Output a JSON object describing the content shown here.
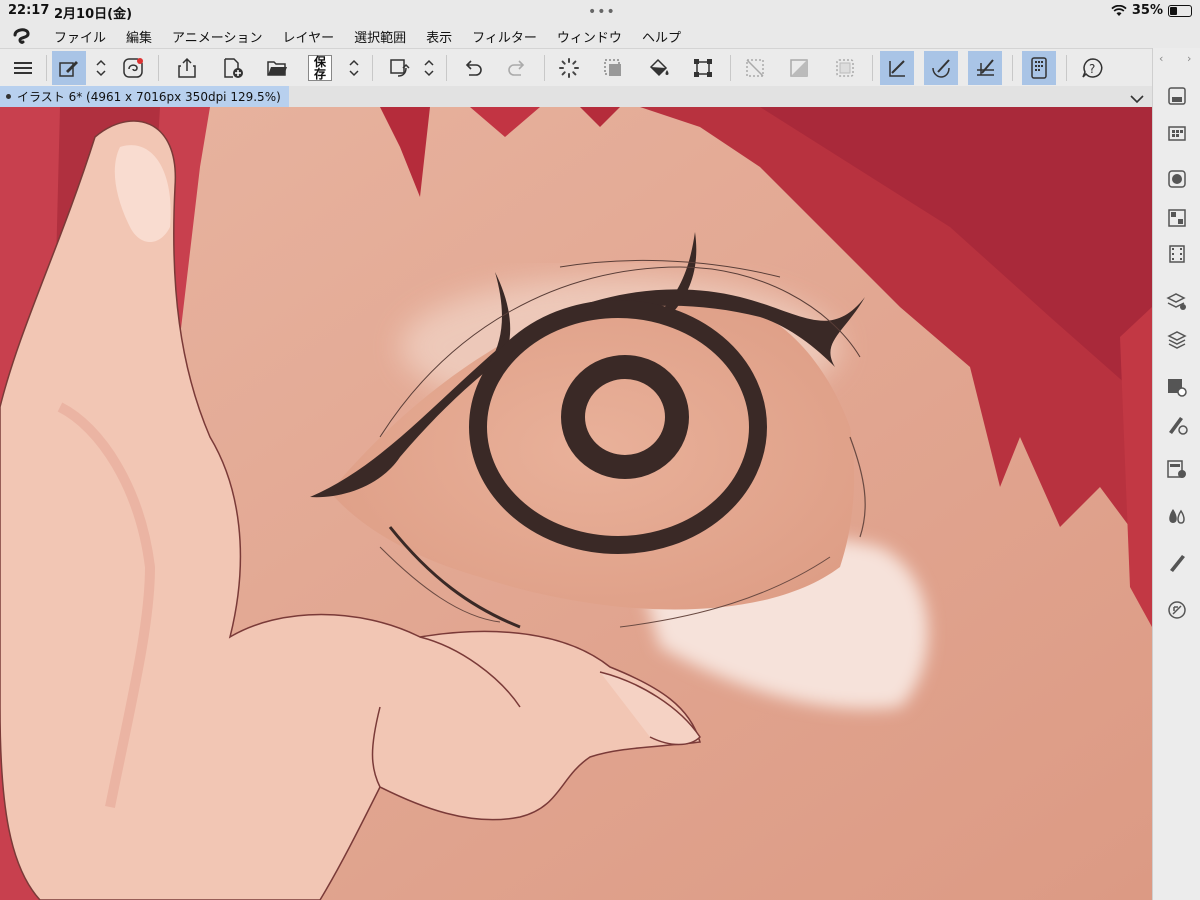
{
  "status": {
    "time": "22:17",
    "date": "2月10日(金)",
    "battery": "35%",
    "battery_level": 0.35
  },
  "menu": [
    "ファイル",
    "編集",
    "アニメーション",
    "レイヤー",
    "選択範囲",
    "表示",
    "フィルター",
    "ウィンドウ",
    "ヘルプ"
  ],
  "toolbar": {
    "save_label_top": "保",
    "save_label_bottom": "存",
    "icons": [
      "menu-icon",
      "edit-icon",
      "quick-access-icon",
      "share-icon",
      "new-file-icon",
      "open-folder-icon",
      "save-icon",
      "rotate-icon",
      "undo-icon",
      "redo-icon",
      "select-spinner-icon",
      "select-dotted-icon",
      "fill-bucket-icon",
      "transform-icon",
      "deselect-icon",
      "gradient-icon",
      "marquee-icon",
      "ruler-snap-icon",
      "brush-snap-icon",
      "angle-snap-icon",
      "device-icon",
      "help-icon"
    ]
  },
  "document": {
    "tab_title": "イラスト 6* (4961 x 7016px 350dpi 129.5%)"
  },
  "right_panel": {
    "icons": [
      "save-panel-icon",
      "material-icon",
      "circle-panel-icon",
      "color-set-icon",
      "animation-icon",
      "layer-property-icon",
      "layers-icon",
      "subtool-settings-icon",
      "tool-property-icon",
      "layer-adjust-icon",
      "color-drop-icon",
      "pen-icon",
      "navigator-icon"
    ]
  },
  "colors": {
    "accent": "#a9c4e6",
    "skin": "#e0a08a",
    "hair": "#c0303e",
    "ink": "#3d2c27"
  }
}
